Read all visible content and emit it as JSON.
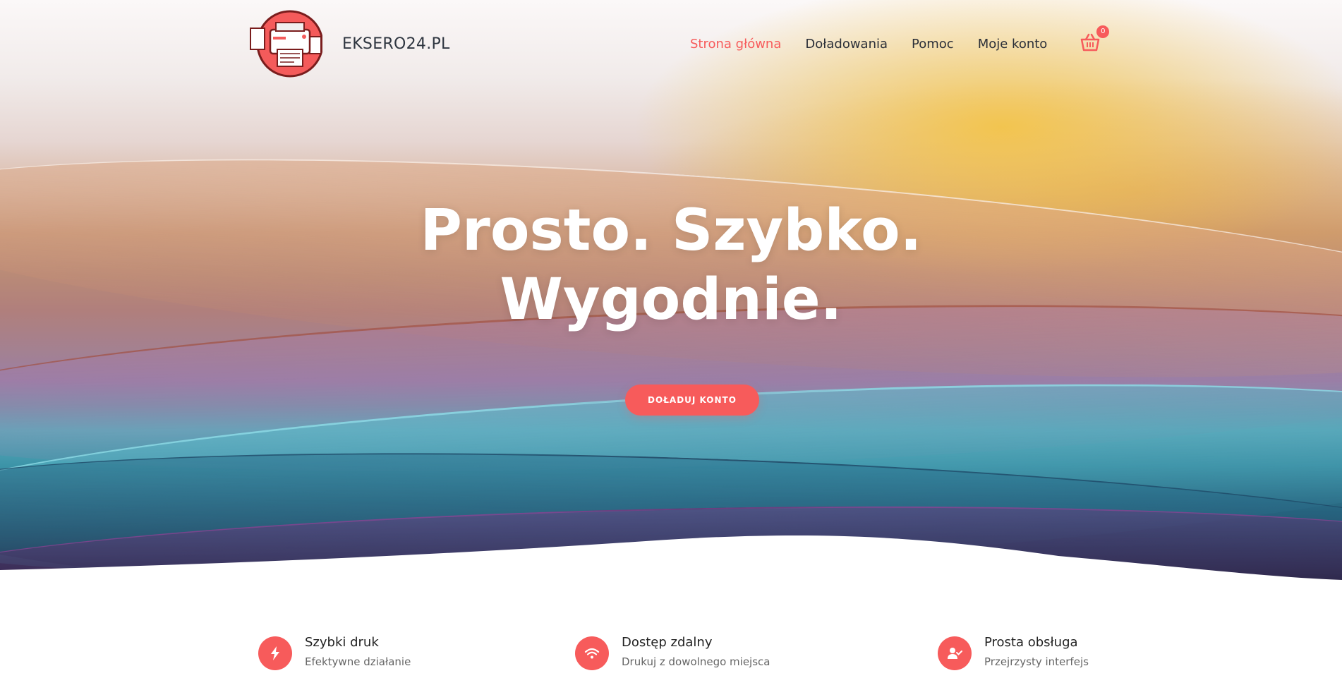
{
  "header": {
    "brand": "EKSERO24.PL",
    "nav": [
      {
        "label": "Strona główna",
        "active": true
      },
      {
        "label": "Doładowania",
        "active": false
      },
      {
        "label": "Pomoc",
        "active": false
      },
      {
        "label": "Moje konto",
        "active": false
      }
    ],
    "cart": {
      "icon": "basket-icon",
      "count": "0"
    }
  },
  "hero": {
    "title_line1": "Prosto. Szybko.",
    "title_line2": "Wygodnie.",
    "cta_label": "DOŁADUJ KONTO"
  },
  "features": [
    {
      "icon": "lightning-icon",
      "title": "Szybki druk",
      "subtitle": "Efektywne działanie"
    },
    {
      "icon": "wifi-icon",
      "title": "Dostęp zdalny",
      "subtitle": "Drukuj z dowolnego miejsca"
    },
    {
      "icon": "user-check-icon",
      "title": "Prosta obsługa",
      "subtitle": "Przejrzysty interfejs"
    }
  ],
  "colors": {
    "accent": "#f75b5b",
    "text_dark": "#2b2f38",
    "text_muted": "#666666"
  }
}
